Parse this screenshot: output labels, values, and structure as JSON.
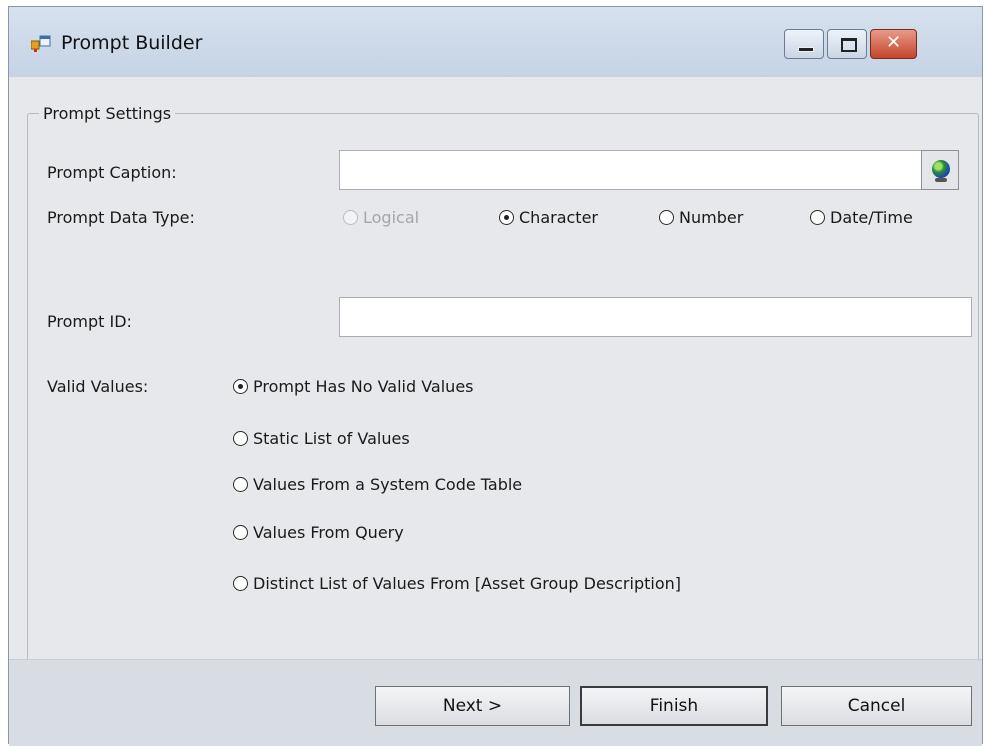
{
  "window": {
    "title": "Prompt Builder",
    "close_glyph": "✕",
    "icons": {
      "app": "prompt-builder-app-icon",
      "minimize": "minimize-icon",
      "maximize": "maximize-icon",
      "close": "close-icon"
    }
  },
  "group": {
    "legend": "Prompt Settings"
  },
  "caption": {
    "label": "Prompt Caption:",
    "value": "",
    "button_icon": "globe-icon"
  },
  "data_type": {
    "label": "Prompt Data Type:",
    "options": [
      {
        "label": "Logical",
        "checked": false,
        "enabled": false
      },
      {
        "label": "Character",
        "checked": true,
        "enabled": true
      },
      {
        "label": "Number",
        "checked": false,
        "enabled": true
      },
      {
        "label": "Date/Time",
        "checked": false,
        "enabled": true
      }
    ]
  },
  "prompt_id": {
    "label": "Prompt ID:",
    "value": ""
  },
  "valid_values": {
    "label": "Valid Values:",
    "options": [
      {
        "label": "Prompt Has No Valid Values",
        "checked": true
      },
      {
        "label": "Static List of Values",
        "checked": false
      },
      {
        "label": "Values From a System Code Table",
        "checked": false
      },
      {
        "label": "Values From Query",
        "checked": false
      },
      {
        "label": "Distinct List of Values From [Asset Group Description]",
        "checked": false
      }
    ]
  },
  "buttons": {
    "next": "Next >",
    "finish": "Finish",
    "cancel": "Cancel"
  },
  "colors": {
    "content_bg": "#e6e8eb",
    "footer_bg": "#d8dce3",
    "close_red": "#c4442c"
  }
}
